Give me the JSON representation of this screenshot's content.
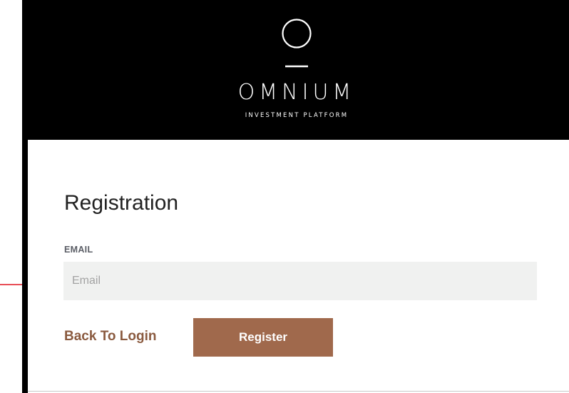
{
  "brand": {
    "name": "OMNIUM",
    "tagline": "INVESTMENT PLATFORM"
  },
  "page": {
    "title": "Registration"
  },
  "form": {
    "email_label": "EMAIL",
    "email_placeholder": "Email",
    "email_value": ""
  },
  "actions": {
    "back_to_login": "Back To Login",
    "register": "Register"
  },
  "colors": {
    "header_bg": "#000000",
    "accent": "#a0694c",
    "link": "#8a5a3f",
    "input_bg": "#f0f1f0",
    "annotation": "#e0141e"
  },
  "icons": {
    "logo": "omnium-logo-icon",
    "annotation": "annotation-arrow-icon"
  }
}
